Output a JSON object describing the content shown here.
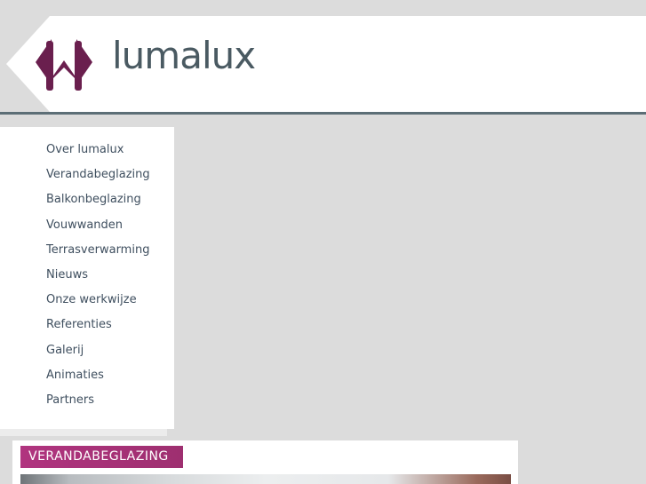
{
  "brand": {
    "name": "lumalux",
    "accent": "#6a1f4e",
    "text_color": "#4a5a62"
  },
  "nav": {
    "items": [
      "Over lumalux",
      "Verandabeglazing",
      "Balkonbeglazing",
      "Vouwwanden",
      "Terrasverwarming",
      "Nieuws",
      "Onze werkwijze",
      "Referenties",
      "Galerij",
      "Animaties",
      "Partners"
    ]
  },
  "content": {
    "section_title": "VERANDABEGLAZING",
    "title_color": "#b0347f"
  }
}
